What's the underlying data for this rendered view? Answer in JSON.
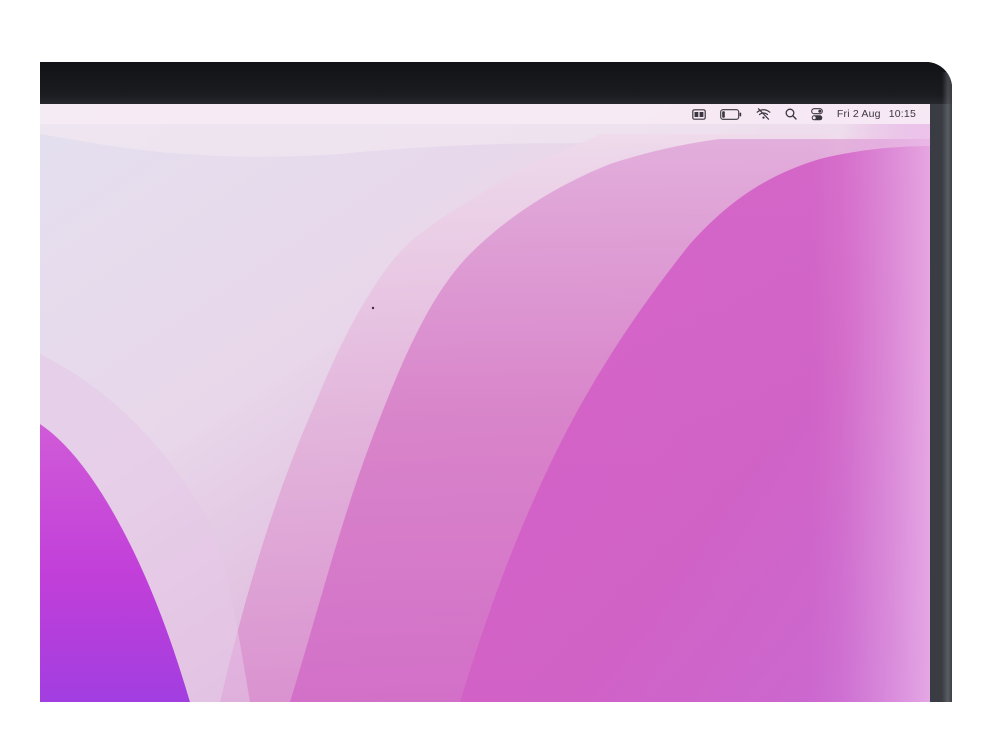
{
  "menubar": {
    "icons": [
      {
        "name": "display-icon"
      },
      {
        "name": "battery-icon"
      },
      {
        "name": "wifi-off-icon"
      },
      {
        "name": "search-icon"
      },
      {
        "name": "control-center-icon"
      }
    ],
    "date": "Fri 2 Aug",
    "time": "10:15"
  },
  "colors": {
    "wallpaper_light": "#e9dcec",
    "wallpaper_pink": "#d76fc3",
    "wallpaper_magenta": "#c43fd6",
    "bezel": "#1b1c20"
  }
}
